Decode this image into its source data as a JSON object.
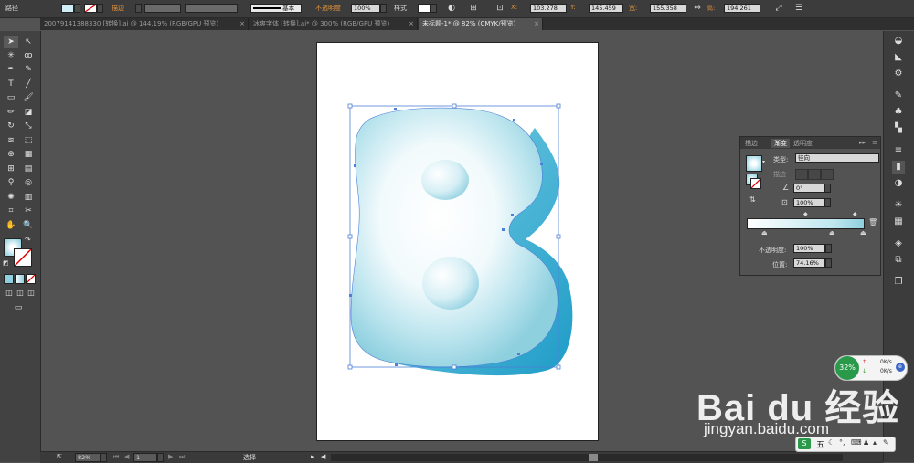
{
  "control_bar": {
    "object_type": "路径",
    "stroke_label": "描边",
    "stroke_style": "基本",
    "opacity_label": "不透明度",
    "opacity_value": "100%",
    "style_label": "样式",
    "x_label": "X:",
    "x_value": "103.278",
    "y_label": "Y:",
    "y_value": "145.459",
    "w_label": "宽:",
    "w_value": "155.358",
    "h_label": "高:",
    "h_value": "194.261"
  },
  "tabs": [
    {
      "label": "20079141388330 [转换].ai @ 144.19% (RGB/GPU 预览)",
      "active": false
    },
    {
      "label": "冰爽字体 [转换].ai* @ 300% (RGB/GPU 预览)",
      "active": false
    },
    {
      "label": "未标题-1* @ 82% (CMYK/预览)",
      "active": true
    }
  ],
  "gradient_panel": {
    "tabs": [
      "描边",
      "渐变",
      "透明度"
    ],
    "active_tab": "渐变",
    "type_label": "类型:",
    "type_value": "径向",
    "stroke_label": "描边",
    "angle_value": "0°",
    "aspect_value": "100%",
    "opacity_label": "不透明度:",
    "opacity_value": "100%",
    "location_label": "位置:",
    "location_value": "74.16%",
    "gradient_start": "#ffffff",
    "gradient_end": "#8fd0df"
  },
  "status_bar": {
    "zoom": "82%",
    "page": "1",
    "tool_name": "选择"
  },
  "net_widget": {
    "percent": "32%",
    "up": "0K/s",
    "down": "0K/s"
  },
  "watermark": {
    "brand": "Bai du 经验",
    "url": "jingyan.baidu.com"
  },
  "ime_bar": {
    "label": "五"
  },
  "colors": {
    "letter_light": "#ffffff",
    "letter_mid": "#bfe6ef",
    "letter_shadow": "#1e9cc7",
    "selection": "#4d7fd6",
    "accent_orange": "#e0923a"
  }
}
